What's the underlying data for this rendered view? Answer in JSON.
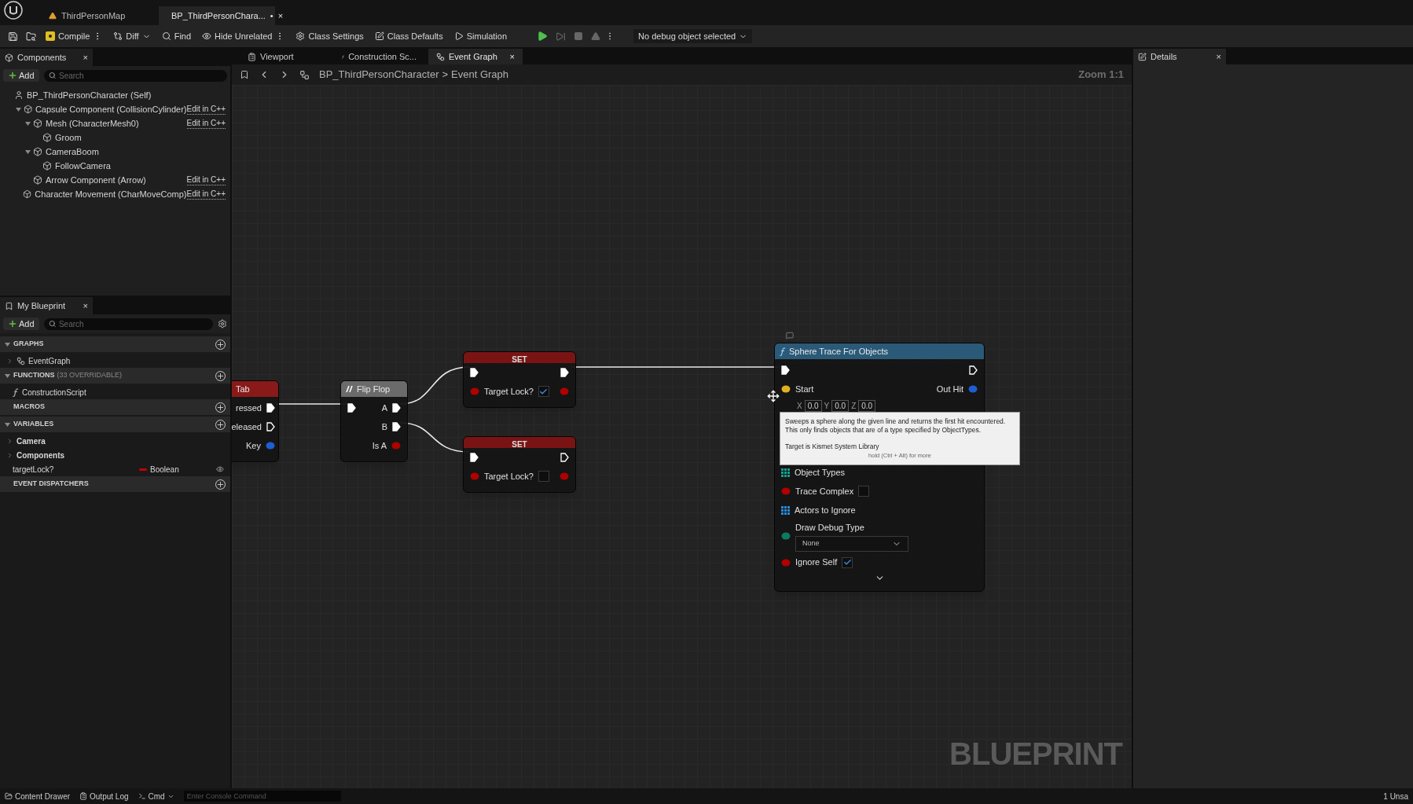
{
  "doc_tabs": [
    {
      "label": "ThirdPersonMap",
      "selected": false
    },
    {
      "label": "BP_ThirdPersonChara...",
      "mark": "•",
      "close": "×",
      "selected": true
    }
  ],
  "toolbar": {
    "compile": "Compile",
    "diff": "Diff",
    "find": "Find",
    "hide_unrelated": "Hide Unrelated",
    "class_settings": "Class Settings",
    "class_defaults": "Class Defaults",
    "simulation": "Simulation",
    "debug_object": "No debug object selected"
  },
  "components": {
    "title": "Components",
    "close": "×",
    "add": "Add",
    "search": {
      "placeholder": "Search"
    },
    "tree": [
      {
        "label": "BP_ThirdPersonCharacter (Self)",
        "children": [
          {
            "label": "Capsule Component (CollisionCylinder)",
            "link": "Edit in C++",
            "expanded": true,
            "children": [
              {
                "label": "Mesh (CharacterMesh0)",
                "link": "Edit in C++",
                "expanded": true,
                "children": [
                  {
                    "label": "Groom"
                  }
                ]
              },
              {
                "label": "CameraBoom",
                "expanded": true,
                "children": [
                  {
                    "label": "FollowCamera"
                  }
                ]
              },
              {
                "label": "Arrow Component (Arrow)",
                "link": "Edit in C++"
              }
            ]
          },
          {
            "label": "Character Movement (CharMoveComp)",
            "link": "Edit in C++"
          }
        ]
      }
    ]
  },
  "my_blueprint": {
    "title": "My Blueprint",
    "close": "×",
    "add": "Add",
    "search": {
      "placeholder": "Search"
    },
    "sections": [
      {
        "title": "GRAPHS",
        "expanded": true,
        "items": [
          {
            "kind": "graph",
            "label": "EventGraph"
          }
        ]
      },
      {
        "title": "FUNCTIONS",
        "note": "(33 OVERRIDABLE)",
        "expanded": true,
        "items": [
          {
            "kind": "function",
            "label": "ConstructionScript"
          }
        ]
      },
      {
        "title": "MACROS"
      },
      {
        "title": "VARIABLES",
        "expanded": true,
        "items": [
          {
            "kind": "category",
            "label": "Camera"
          },
          {
            "kind": "category",
            "label": "Components"
          },
          {
            "kind": "variable",
            "label": "targetLock?",
            "type": "Boolean",
            "color": "#c40000"
          }
        ]
      },
      {
        "title": "EVENT DISPATCHERS"
      }
    ]
  },
  "editor_tabs": [
    {
      "label": "Viewport",
      "selected": false
    },
    {
      "label": "Construction Sc...",
      "selected": false
    },
    {
      "label": "Event Graph",
      "close": "×",
      "selected": true
    }
  ],
  "breadcrumb": [
    "BP_ThirdPersonCharacter",
    "Event Graph"
  ],
  "breadcrumb_separator": ">",
  "zoom": "Zoom 1:1",
  "nodes": [
    {
      "kind": "event",
      "title": "Tab",
      "color": "#8a1a1a",
      "rows": [
        {
          "kind": "pins",
          "out_label": "ressed",
          "out": {
            "connected": true
          }
        },
        {
          "kind": "pins",
          "out_label": "eleased",
          "out": {
            "connected": false
          }
        },
        {
          "kind": "pins",
          "out_label": "Key",
          "out": {
            "color": "#1e5ed0"
          }
        }
      ]
    },
    {
      "kind": "macro",
      "title": "Flip Flop",
      "color": "#6b6b6b",
      "rows": [
        {
          "kind": "pins",
          "in": {
            "connected": true
          },
          "out_label": "A",
          "out": {
            "connected": true
          }
        },
        {
          "kind": "pins",
          "out_label": "B",
          "out": {
            "connected": true
          }
        },
        {
          "kind": "pins",
          "out_label": "Is A",
          "out": {
            "color": "#b00000"
          }
        }
      ]
    },
    {
      "kind": "set",
      "title": "SET",
      "color": "#7a1414",
      "rows": [
        {
          "kind": "pins",
          "in": {
            "connected": true
          },
          "out": {
            "connected": true
          }
        },
        {
          "kind": "pins",
          "in": {
            "color": "#b00000"
          },
          "label": "Target Lock?",
          "checked": true,
          "out": {
            "color": "#b00000"
          }
        }
      ]
    },
    {
      "kind": "set",
      "title": "SET",
      "color": "#7a1414",
      "rows": [
        {
          "kind": "pins",
          "in": {
            "connected": true
          },
          "out": {
            "connected": false
          }
        },
        {
          "kind": "pins",
          "in": {
            "color": "#b00000"
          },
          "label": "Target Lock?",
          "checked": false,
          "out": {
            "color": "#b00000"
          }
        }
      ]
    },
    {
      "kind": "function",
      "title": "Sphere Trace For Objects",
      "color": "#2a5a78",
      "rows": [
        {
          "kind": "pins",
          "in": {
            "connected": true
          },
          "out": {
            "connected": false
          }
        },
        {
          "kind": "pins",
          "in": {
            "color": "#e0b020"
          },
          "label": "Start",
          "out_label": "Out Hit",
          "out": {
            "color": "#1e5ed0"
          }
        },
        {
          "kind": "vector",
          "fields": [
            {
              "axis": "X",
              "value": "0.0"
            },
            {
              "axis": "Y",
              "value": "0.0"
            },
            {
              "axis": "Z",
              "value": "0.0"
            }
          ]
        },
        {
          "kind": "array",
          "label": "Object Types",
          "color": "#14a090"
        },
        {
          "kind": "pins",
          "in": {
            "color": "#b00000"
          },
          "label": "Trace Complex",
          "checked": false
        },
        {
          "kind": "array",
          "label": "Actors to Ignore",
          "color": "#2a8ad8"
        },
        {
          "kind": "enum",
          "in": {
            "color": "#0c7a60"
          },
          "label": "Draw Debug Type",
          "value": "None"
        },
        {
          "kind": "pins",
          "in": {
            "color": "#b00000"
          },
          "label": "Ignore Self",
          "checked": true
        },
        {
          "kind": "more"
        }
      ]
    }
  ],
  "tooltip": {
    "lines": [
      "Sweeps a sphere along the given line and returns the first hit encountered.",
      "This only finds objects that are of a type specified by ObjectTypes."
    ],
    "target": "Target is Kismet System Library",
    "hint": "hold (Ctrl + Alt) for more"
  },
  "watermark": "BLUEPRINT",
  "details": {
    "title": "Details",
    "close": "×"
  },
  "status_bar": {
    "content_drawer": "Content Drawer",
    "output_log": "Output Log",
    "cmd": "Cmd",
    "console": {
      "placeholder": "Enter Console Command"
    },
    "unsaved": "1 Unsa"
  }
}
